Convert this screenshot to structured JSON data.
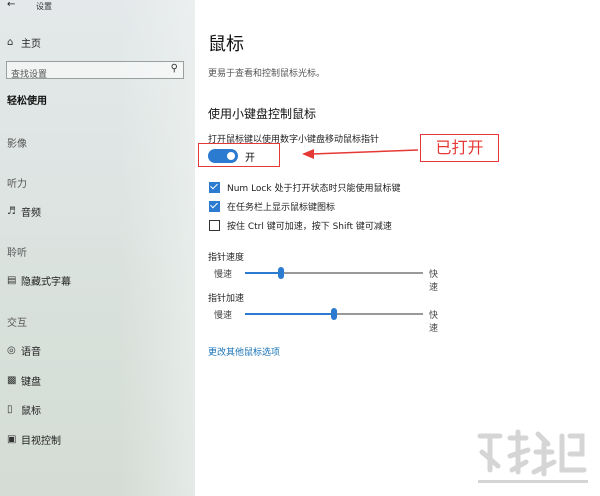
{
  "window": {
    "title": "设置"
  },
  "sidebar": {
    "home_label": "主页",
    "search_placeholder": "查找设置",
    "active_category": "轻松使用",
    "sections": [
      {
        "heading": "影像"
      },
      {
        "heading": "听力"
      },
      {
        "heading": "聆听"
      },
      {
        "heading": "交互"
      }
    ],
    "items": {
      "audio": "音频",
      "captions": "隐藏式字幕",
      "speech": "语音",
      "keyboard": "键盘",
      "mouse": "鼠标",
      "eye_control": "目视控制"
    }
  },
  "main": {
    "title": "鼠标",
    "description": "更易于查看和控制鼠标光标。",
    "section_title": "使用小键盘控制鼠标",
    "toggle": {
      "label": "打开鼠标键以使用数字小键盘移动鼠标指针",
      "state_text": "开",
      "on": true
    },
    "checkboxes": [
      {
        "label": "Num Lock 处于打开状态时只能使用鼠标键",
        "checked": true
      },
      {
        "label": "在任务栏上显示鼠标键图标",
        "checked": true
      },
      {
        "label": "按住 Ctrl 键可加速，按下 Shift 键可减速",
        "checked": false
      }
    ],
    "sliders": [
      {
        "title": "指针速度",
        "low_label": "慢速",
        "high_label": "快速",
        "value_fraction": 0.2
      },
      {
        "title": "指针加速",
        "low_label": "慢速",
        "high_label": "快速",
        "value_fraction": 0.5
      }
    ],
    "link_text": "更改其他鼠标选项"
  },
  "annotation": {
    "callout_text": "已打开",
    "color": "#e53935"
  },
  "colors": {
    "accent": "#2b7bd0"
  }
}
